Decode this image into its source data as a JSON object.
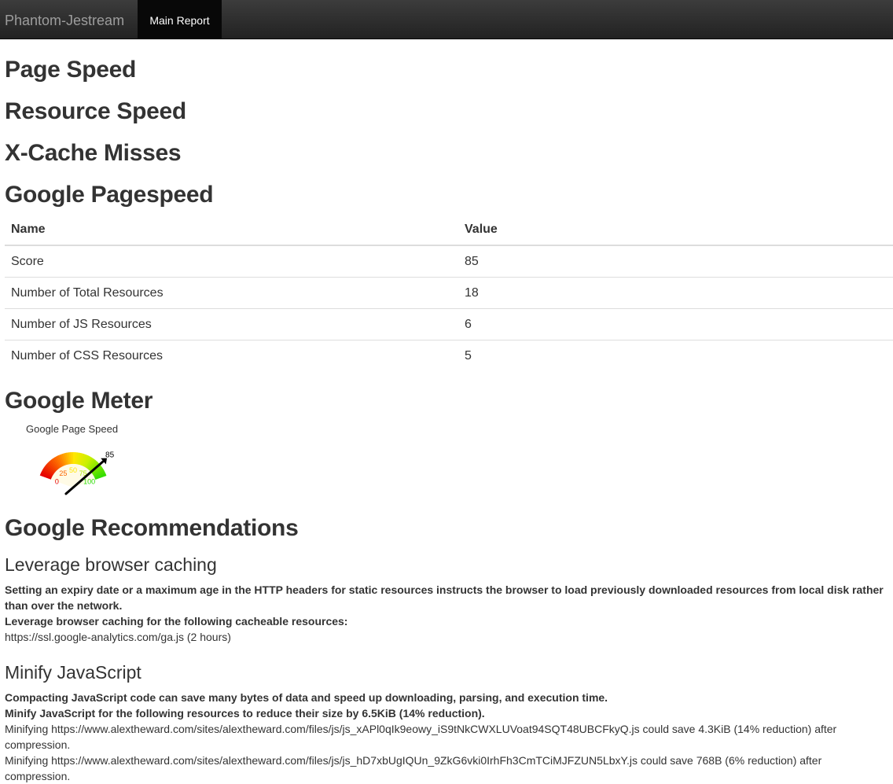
{
  "navbar": {
    "brand": "Phantom-Jestream",
    "active_item": "Main Report"
  },
  "sections": {
    "page_speed": "Page Speed",
    "resource_speed": "Resource Speed",
    "xcache_misses": "X-Cache Misses",
    "google_pagespeed": "Google Pagespeed",
    "google_meter": "Google Meter",
    "google_recommendations": "Google Recommendations"
  },
  "pagespeed_table": {
    "headers": [
      "Name",
      "Value"
    ],
    "rows": [
      {
        "name": "Score",
        "value": "85"
      },
      {
        "name": "Number of Total Resources",
        "value": "18"
      },
      {
        "name": "Number of JS Resources",
        "value": "6"
      },
      {
        "name": "Number of CSS Resources",
        "value": "5"
      }
    ]
  },
  "meter": {
    "title": "Google Page Speed",
    "value": 85,
    "value_label": "85",
    "ticks": [
      "0",
      "25",
      "50",
      "75",
      "100"
    ],
    "colors": {
      "red": "#e60000",
      "orange": "#ff9900",
      "yellow": "#ffee00",
      "green": "#33dd00"
    }
  },
  "recommendations": [
    {
      "title": "Leverage browser caching",
      "summary": "Setting an expiry date or a maximum age in the HTTP headers for static resources instructs the browser to load previously downloaded resources from local disk rather than over the network.",
      "subheading": "Leverage browser caching for the following cacheable resources:",
      "items": [
        "https://ssl.google-analytics.com/ga.js (2 hours)"
      ]
    },
    {
      "title": "Minify JavaScript",
      "summary": "Compacting JavaScript code can save many bytes of data and speed up downloading, parsing, and execution time.",
      "subheading": "Minify JavaScript for the following resources to reduce their size by 6.5KiB (14% reduction).",
      "items": [
        "Minifying https://www.alextheward.com/sites/alextheward.com/files/js/js_xAPl0qIk9eowy_iS9tNkCWXLUVoat94SQT48UBCFkyQ.js could save 4.3KiB (14% reduction) after compression.",
        "Minifying https://www.alextheward.com/sites/alextheward.com/files/js/js_hD7xbUgIQUn_9ZkG6vki0IrhFh3CmTCiMJFZUN5LbxY.js could save 768B (6% reduction) after compression."
      ]
    }
  ]
}
